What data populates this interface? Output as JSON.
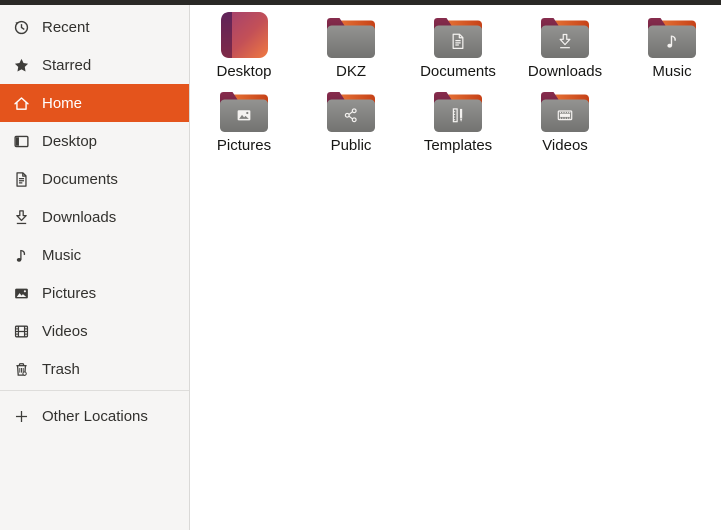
{
  "window": {
    "app": "Files (Nautilus)",
    "current_location": "Home"
  },
  "sidebar": {
    "items": [
      {
        "label": "Recent",
        "icon": "recent-icon",
        "selected": false
      },
      {
        "label": "Starred",
        "icon": "starred-icon",
        "selected": false
      },
      {
        "label": "Home",
        "icon": "home-icon",
        "selected": true
      },
      {
        "label": "Desktop",
        "icon": "desktop-icon",
        "selected": false
      },
      {
        "label": "Documents",
        "icon": "documents-icon",
        "selected": false
      },
      {
        "label": "Downloads",
        "icon": "downloads-icon",
        "selected": false
      },
      {
        "label": "Music",
        "icon": "music-icon",
        "selected": false
      },
      {
        "label": "Pictures",
        "icon": "pictures-icon",
        "selected": false
      },
      {
        "label": "Videos",
        "icon": "videos-icon",
        "selected": false
      },
      {
        "label": "Trash",
        "icon": "trash-icon",
        "selected": false
      }
    ],
    "footer_item": {
      "label": "Other Locations",
      "icon": "plus-icon"
    }
  },
  "files": {
    "items": [
      {
        "label": "Desktop",
        "icon": "desktop-gradient-icon"
      },
      {
        "label": "DKZ",
        "icon": "plain-folder-icon"
      },
      {
        "label": "Documents",
        "icon": "documents-folder-icon"
      },
      {
        "label": "Downloads",
        "icon": "downloads-folder-icon"
      },
      {
        "label": "Music",
        "icon": "music-folder-icon"
      },
      {
        "label": "Pictures",
        "icon": "pictures-folder-icon"
      },
      {
        "label": "Public",
        "icon": "public-folder-icon"
      },
      {
        "label": "Templates",
        "icon": "templates-folder-icon"
      },
      {
        "label": "Videos",
        "icon": "videos-folder-icon"
      }
    ]
  },
  "colors": {
    "accent_selected": "#e4541c",
    "topbar": "#2a2926",
    "sidebar_bg": "#f6f5f4",
    "folder_body_gray": "#8a8a88",
    "folder_tab_aubergine": "#7a2845",
    "folder_back_orange": "#dd5a25",
    "desktop_icon_gradient_start": "#a03f70",
    "desktop_icon_gradient_end": "#f07a41"
  }
}
